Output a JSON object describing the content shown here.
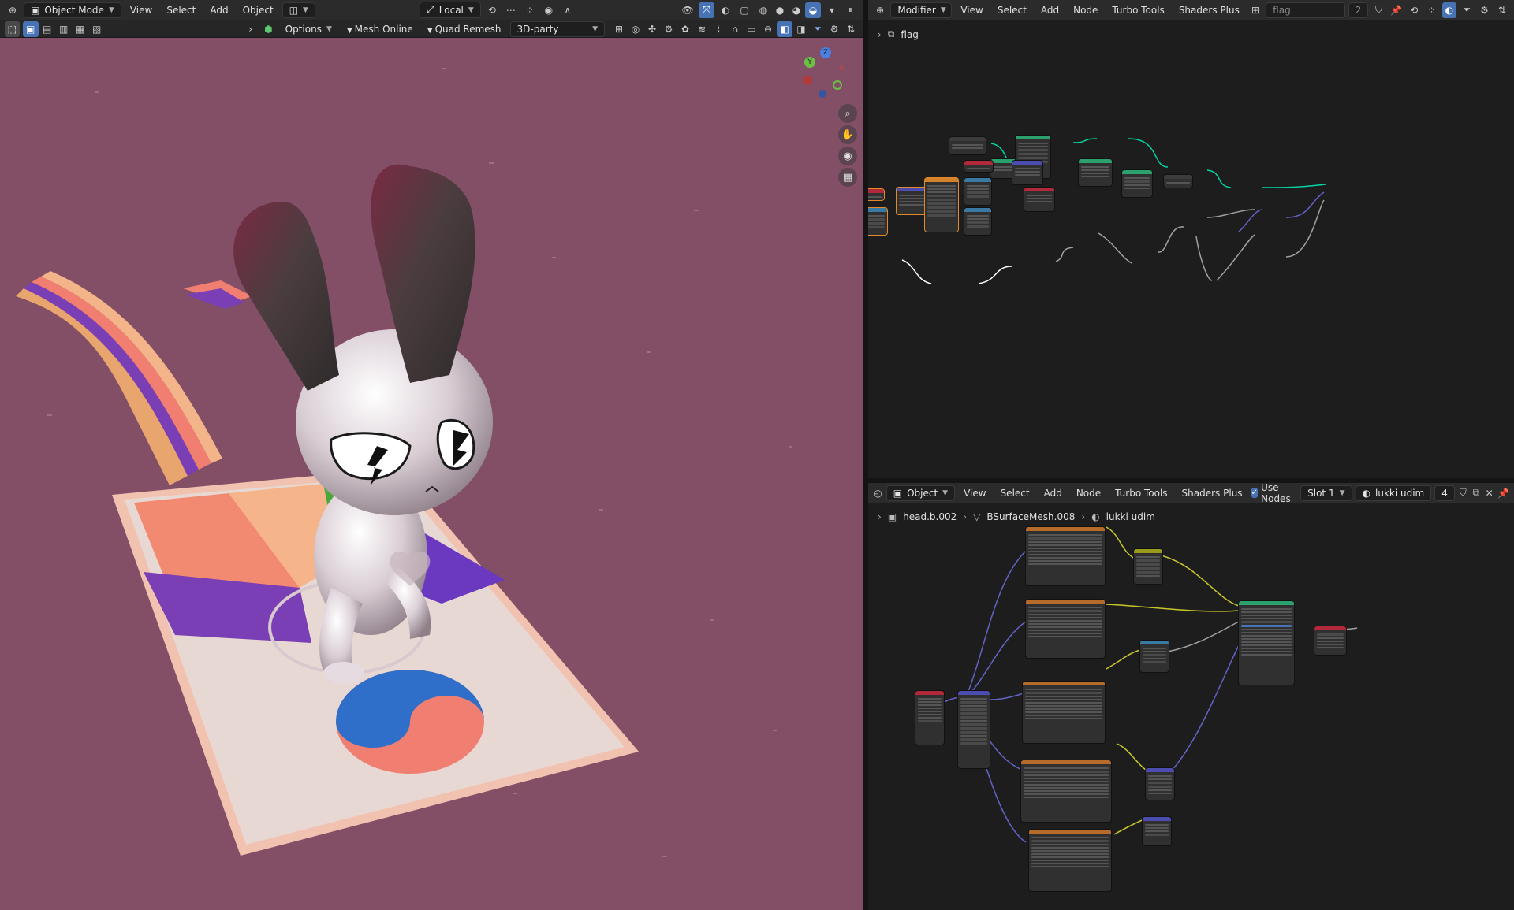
{
  "viewport_header": {
    "mode": "Object Mode",
    "menus": [
      "View",
      "Select",
      "Add",
      "Object"
    ],
    "transform_orientation": "Local"
  },
  "viewport_toolbar": {
    "options_label": "Options",
    "addon_1": "Mesh Online",
    "addon_2": "Quad Remesh",
    "addon_dropdown": "3D-party"
  },
  "gizmo_axes": {
    "x": "X",
    "y": "Y",
    "z": "Z"
  },
  "node_editor_top": {
    "type": "Modifier",
    "menus": [
      "View",
      "Select",
      "Add",
      "Node",
      "Turbo Tools",
      "Shaders Plus"
    ],
    "tree_name": "flag",
    "user_count": "2",
    "breadcrumb": "flag"
  },
  "node_editor_bottom": {
    "type": "Object",
    "menus": [
      "View",
      "Select",
      "Add",
      "Node",
      "Turbo Tools",
      "Shaders Plus"
    ],
    "use_nodes_label": "Use Nodes",
    "slot": "Slot 1",
    "material": "lukki udim",
    "user_count": "4",
    "breadcrumb": [
      "head.b.002",
      "BSurfaceMesh.008",
      "lukki udim"
    ]
  },
  "colors": {
    "viewport_bg": "#824f66",
    "accent": "#4772b3",
    "link_geometry": "#00d6a3",
    "link_color": "#c7c729",
    "link_vector": "#6363c7",
    "link_float": "#a1a1a1"
  }
}
